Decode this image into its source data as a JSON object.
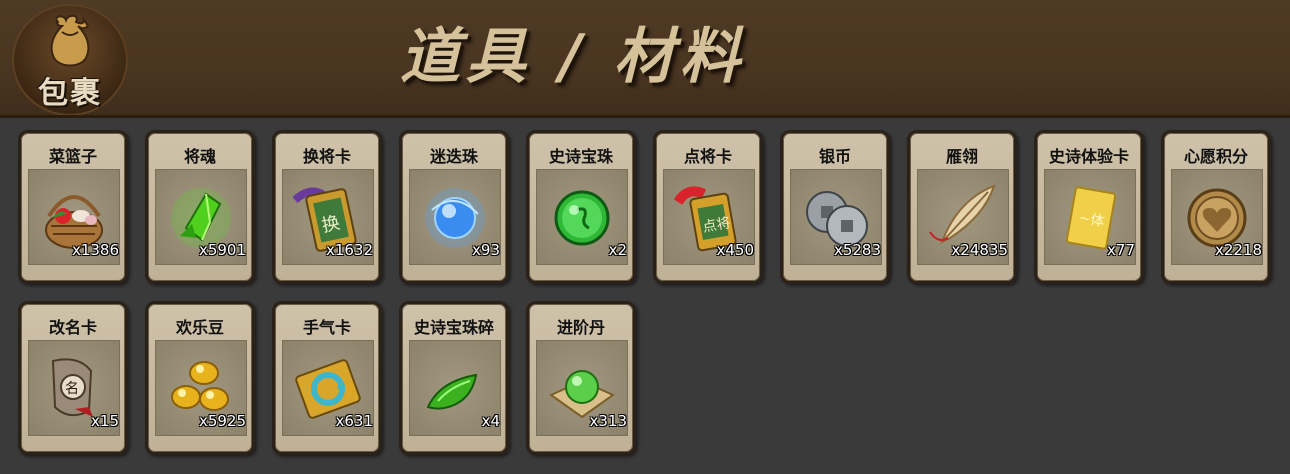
{
  "header": {
    "logo_text": "包裹",
    "title": "道具 / 材料"
  },
  "items": [
    {
      "name": "菜篮子",
      "count": "x1386",
      "icon": "basket-icon",
      "color": "#8a5a2b"
    },
    {
      "name": "将魂",
      "count": "x5901",
      "icon": "green-crystal-icon",
      "color": "#59d42a"
    },
    {
      "name": "换将卡",
      "count": "x1632",
      "icon": "swap-card-icon",
      "color": "#c99a2e"
    },
    {
      "name": "迷迭珠",
      "count": "x93",
      "icon": "blue-orb-icon",
      "color": "#4aa3ff"
    },
    {
      "name": "史诗宝珠",
      "count": "x2",
      "icon": "green-orb-icon",
      "color": "#32c23a"
    },
    {
      "name": "点将卡",
      "count": "x450",
      "icon": "pick-card-icon",
      "color": "#d4a02a"
    },
    {
      "name": "银币",
      "count": "x5283",
      "icon": "silver-coin-icon",
      "color": "#9aa0a6"
    },
    {
      "name": "雁翎",
      "count": "x24835",
      "icon": "feather-icon",
      "color": "#d8c29a"
    },
    {
      "name": "史诗体验卡",
      "count": "x77",
      "icon": "gold-card-icon",
      "color": "#e6c43a"
    },
    {
      "name": "心愿积分",
      "count": "x2218",
      "icon": "heart-coin-icon",
      "color": "#b28a4a"
    },
    {
      "name": "改名卡",
      "count": "x15",
      "icon": "rename-tag-icon",
      "color": "#b04a3a"
    },
    {
      "name": "欢乐豆",
      "count": "x5925",
      "icon": "gold-beans-icon",
      "color": "#e7b21c"
    },
    {
      "name": "手气卡",
      "count": "x631",
      "icon": "luck-card-icon",
      "color": "#3fb5c9"
    },
    {
      "name": "史诗宝珠碎",
      "count": "x4",
      "icon": "green-shard-icon",
      "color": "#3bb11f"
    },
    {
      "name": "进阶丹",
      "count": "x313",
      "icon": "advance-pill-icon",
      "color": "#5ccf4a"
    }
  ]
}
